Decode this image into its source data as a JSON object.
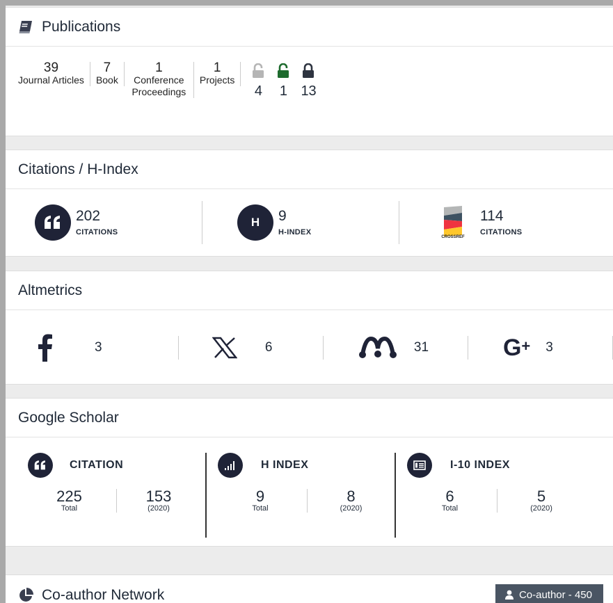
{
  "publications": {
    "title": "Publications",
    "icon": "book-icon",
    "items": [
      {
        "num": "39",
        "label": "Journal Articles"
      },
      {
        "num": "7",
        "label": "Book"
      },
      {
        "num": "1",
        "label": "Conference Proceedings"
      },
      {
        "num": "1",
        "label": "Projects"
      }
    ],
    "access": [
      {
        "icon": "open-lock-gray-icon",
        "count": "4",
        "color": "#b5b5b5"
      },
      {
        "icon": "open-lock-green-icon",
        "count": "1",
        "color": "#1e6b2e"
      },
      {
        "icon": "closed-lock-icon",
        "count": "13",
        "color": "#2e3440"
      }
    ]
  },
  "citations": {
    "title": "Citations / H-Index",
    "items": [
      {
        "icon": "quote-icon",
        "value": "202",
        "label": "CITATIONS"
      },
      {
        "icon": "h-icon",
        "icon_text": "H",
        "value": "9",
        "label": "H-INDEX"
      },
      {
        "icon": "crossref-logo",
        "logo_text": "CROSSREF",
        "value": "114",
        "label": "CITATIONS"
      }
    ]
  },
  "altmetrics": {
    "title": "Altmetrics",
    "items": [
      {
        "icon": "facebook-icon",
        "value": "3"
      },
      {
        "icon": "x-icon",
        "value": "6"
      },
      {
        "icon": "mendeley-icon",
        "value": "31"
      },
      {
        "icon": "google-plus-icon",
        "value": "3"
      }
    ]
  },
  "google_scholar": {
    "title": "Google Scholar",
    "columns": [
      {
        "icon": "quote-icon",
        "label": "CITATION",
        "total": "225",
        "total_label": "Total",
        "recent": "153",
        "recent_label": "(2020)"
      },
      {
        "icon": "signal-bars-icon",
        "label": "H INDEX",
        "total": "9",
        "total_label": "Total",
        "recent": "8",
        "recent_label": "(2020)"
      },
      {
        "icon": "list-box-icon",
        "label": "I-10 INDEX",
        "total": "6",
        "total_label": "Total",
        "recent": "5",
        "recent_label": "(2020)"
      }
    ]
  },
  "coauthor": {
    "title": "Co-author Network",
    "icon": "pie-chart-icon",
    "button_label": "Co-author - 450"
  },
  "colors": {
    "dark_navy": "#1f2337",
    "badge_bg": "#4a5563",
    "page_bg": "#a9a9a9"
  }
}
